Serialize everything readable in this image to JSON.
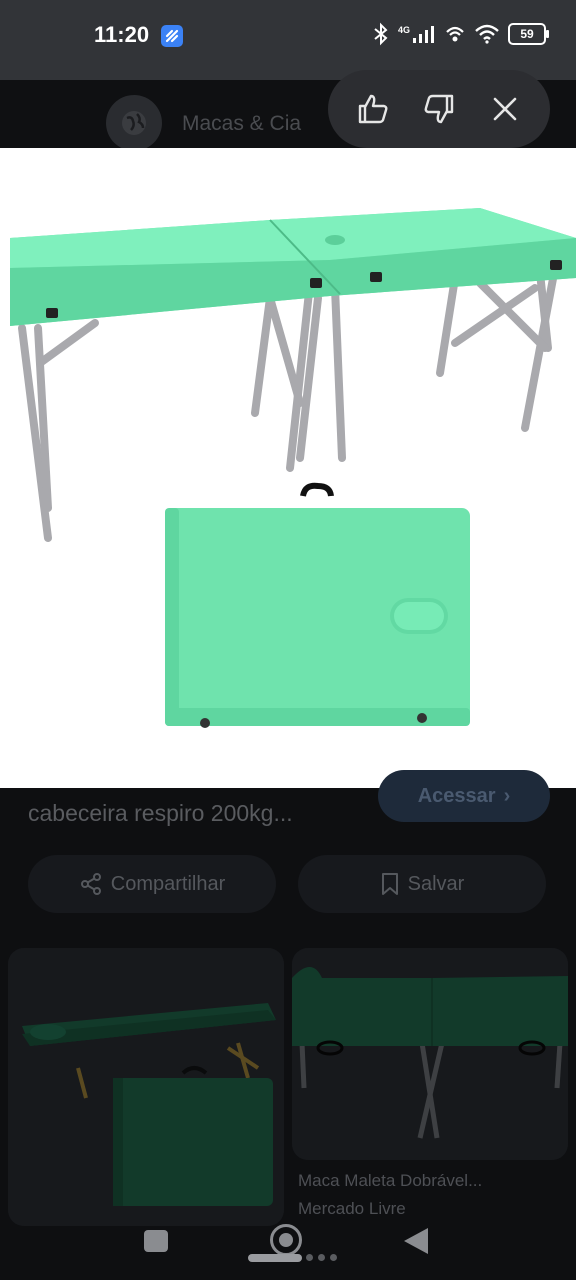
{
  "status_bar": {
    "time": "11:20",
    "network": "4G",
    "battery": "59"
  },
  "header": {
    "site_name": "Macas & Cia",
    "feedback": [
      "thumbs-up-icon",
      "thumbs-down-icon",
      "close-icon"
    ]
  },
  "product": {
    "title": "cabeceira respiro 200kg...",
    "access_label": "Acessar",
    "share_label": "Compartilhar",
    "save_label": "Salvar"
  },
  "related": {
    "right_title": "Maca Maleta Dobrável...",
    "right_source": "Mercado Livre"
  },
  "colors": {
    "table_green": "#6fe3ad",
    "table_green_dark": "#52c993",
    "dim_background": "#0e0f11",
    "accent_dim": "#1e2a3a"
  }
}
